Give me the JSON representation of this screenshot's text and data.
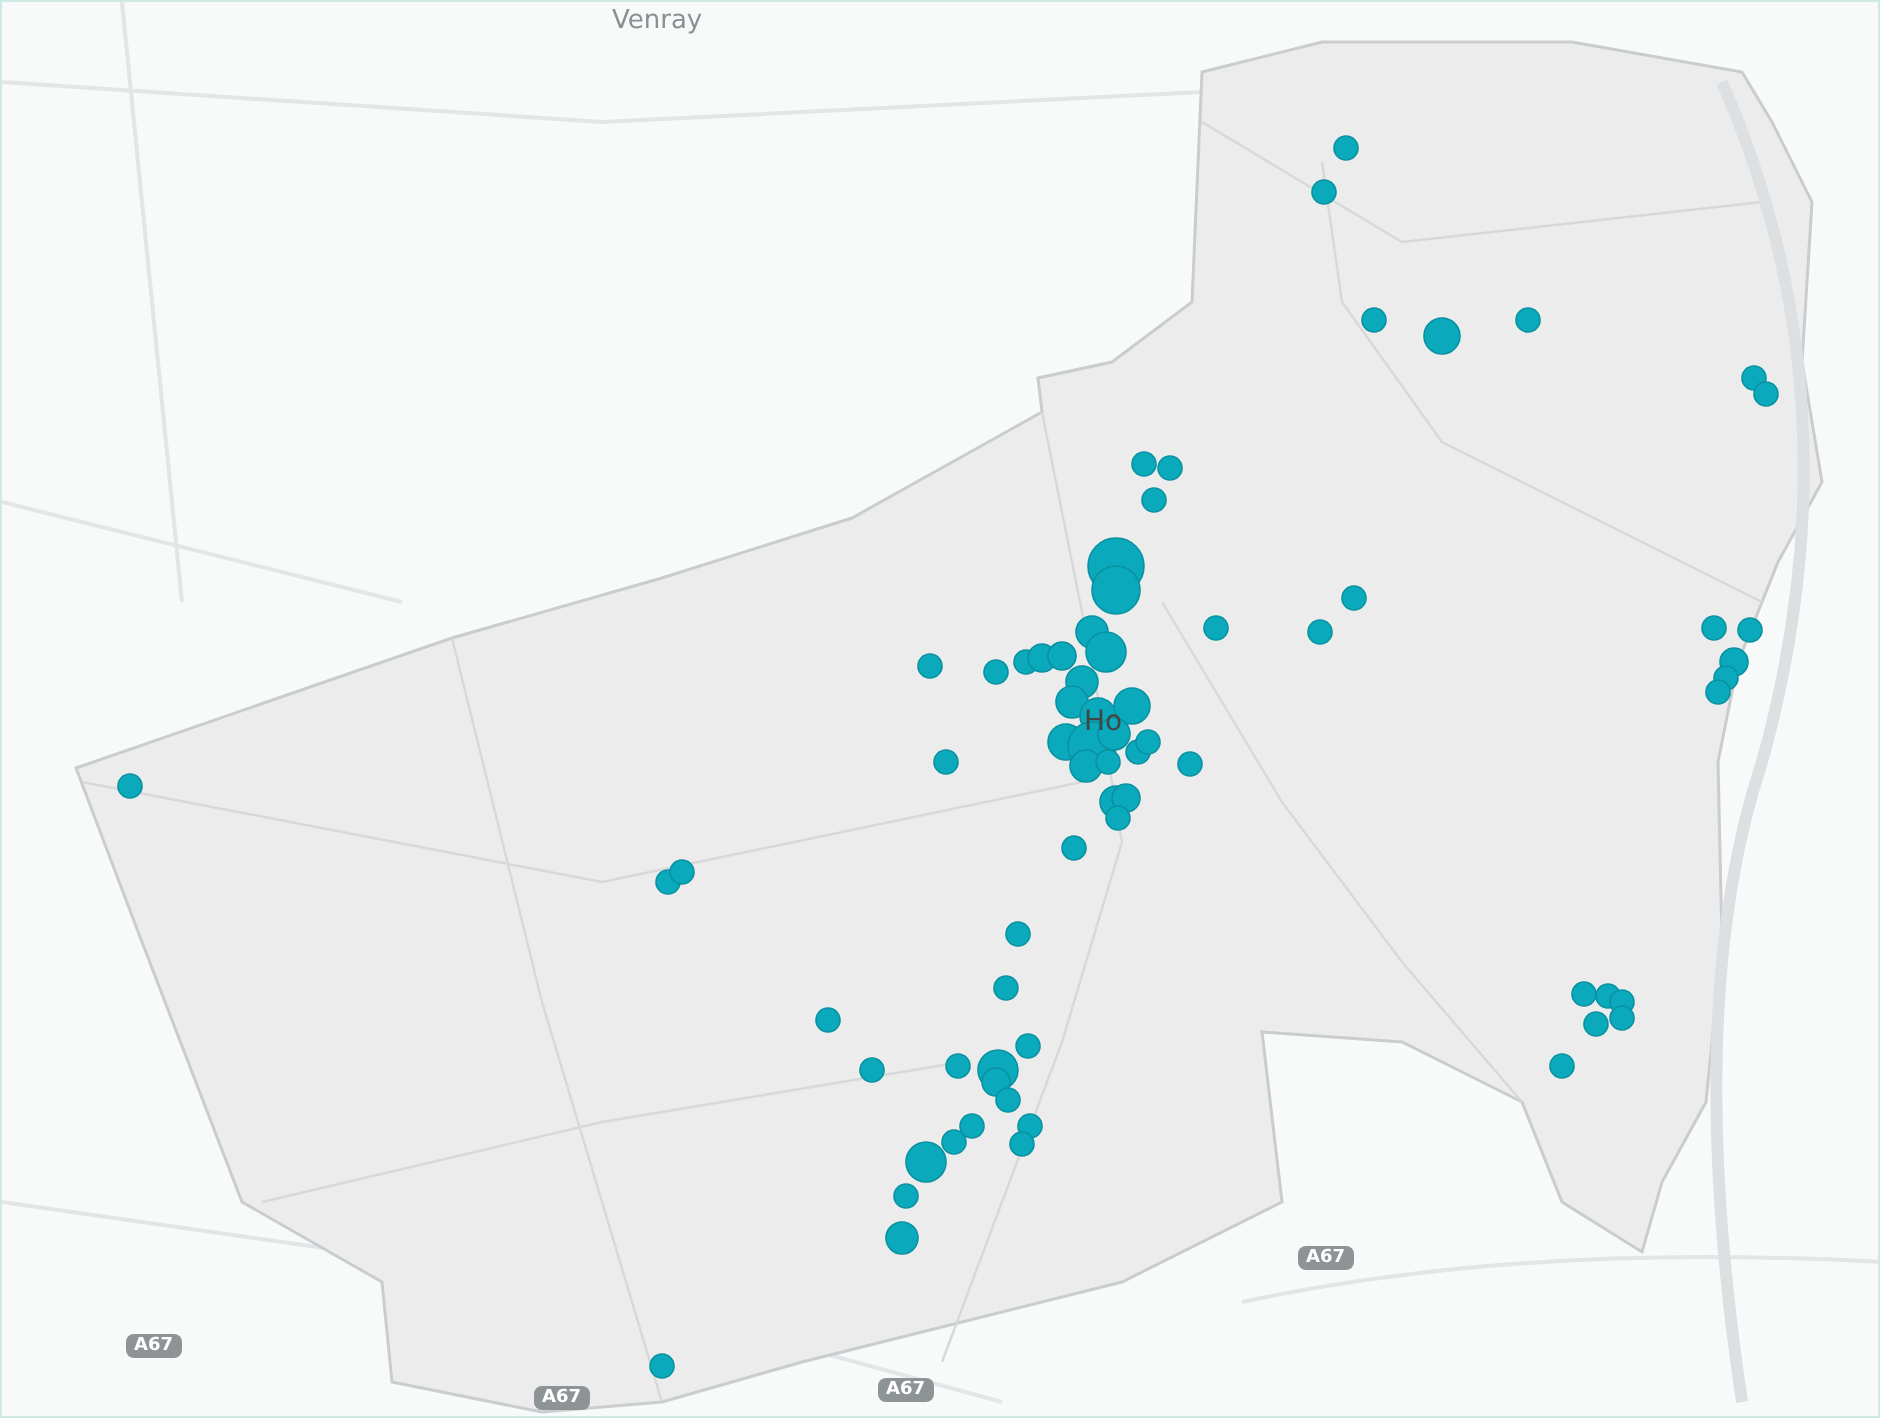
{
  "map": {
    "place_labels": [
      {
        "kind": "town",
        "text": "Venray"
      },
      {
        "kind": "center",
        "text": "Ho"
      }
    ],
    "road_shields": [
      "A67",
      "A67",
      "A67",
      "A67"
    ]
  }
}
